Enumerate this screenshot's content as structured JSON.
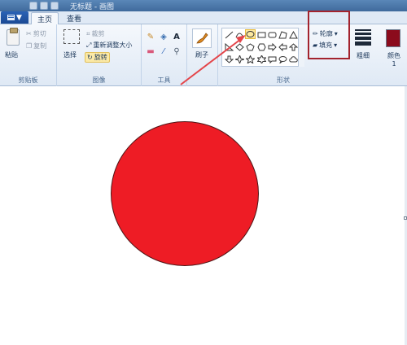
{
  "title_bar": {
    "text": "无标题 - 画图"
  },
  "file_menu": {
    "label": "▼"
  },
  "tabs": [
    {
      "label": "主页"
    },
    {
      "label": "查看"
    }
  ],
  "clipboard": {
    "paste_label": "粘贴",
    "cut_label": "剪切",
    "copy_label": "复制",
    "group_label": "剪贴板"
  },
  "image": {
    "select_label": "选择",
    "crop_label": "裁剪",
    "resize_label": "重新调整大小",
    "rotate_label": "旋转",
    "group_label": "图像"
  },
  "tools": {
    "group_label": "工具",
    "text_glyph": "A"
  },
  "brushes": {
    "label": "刷子"
  },
  "shapes": {
    "group_label": "形状",
    "outline_label": "轮廓",
    "fill_label": "填充"
  },
  "size": {
    "label": "粗细"
  },
  "color1": {
    "label": "颜色 1",
    "swatch": "#8b0b1c"
  },
  "canvas": {
    "fill_color": "#ee1c25",
    "outline_color": "#4d1516"
  },
  "annotation": {
    "arrow_color": "#e4454a",
    "box_color": "#a3232d"
  }
}
